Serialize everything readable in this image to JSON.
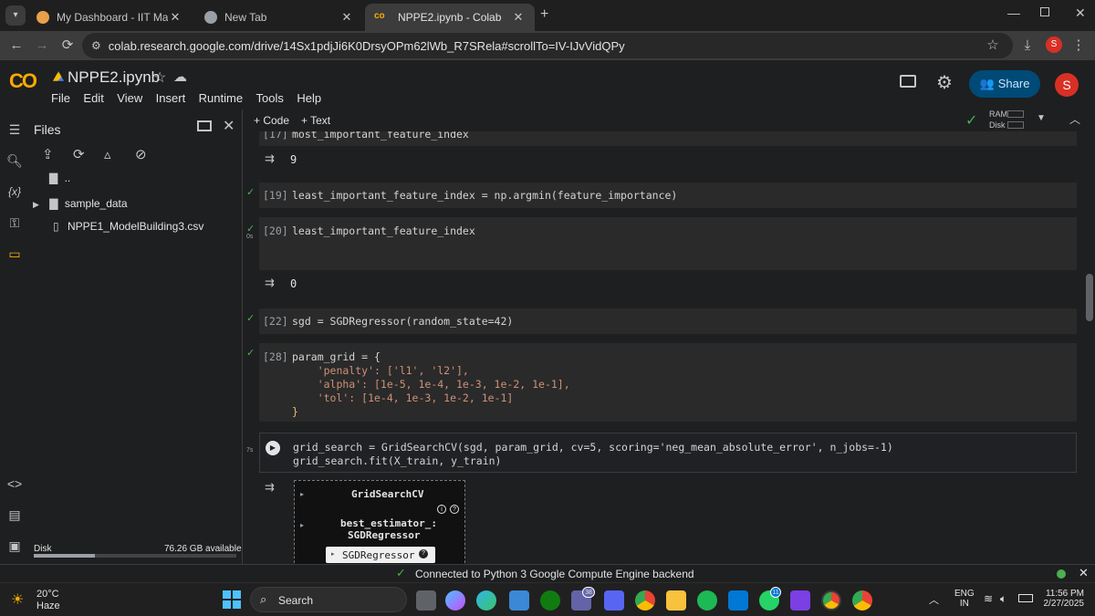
{
  "browser": {
    "tabs": [
      {
        "title": "My Dashboard - IIT Madras Onl"
      },
      {
        "title": "New Tab"
      },
      {
        "title": "NPPE2.ipynb - Colab"
      }
    ],
    "url": "colab.research.google.com/drive/14Sx1pdjJi6K0DrsyOPm62lWb_R7SRela#scrollTo=IV-IJvVidQPy",
    "profile_initial": "S"
  },
  "colab": {
    "logo": "CO",
    "notebook_title": "NPPE2.ipynb",
    "menu": [
      "File",
      "Edit",
      "View",
      "Insert",
      "Runtime",
      "Tools",
      "Help"
    ],
    "share_label": "Share",
    "avatar": "S",
    "add_code": "+ Code",
    "add_text": "+ Text",
    "ram_label": "RAM",
    "disk_label": "Disk"
  },
  "files": {
    "title": "Files",
    "up_label": "..",
    "items": [
      {
        "name": "sample_data"
      },
      {
        "name": "NPPE1_ModelBuilding3.csv"
      }
    ],
    "disk_label": "Disk",
    "disk_available": "76.26 GB available"
  },
  "cells": {
    "c17_num": "[17]",
    "c17_code": "most_important_feature_index",
    "c17_out": "9",
    "c19_num": "[19]",
    "c19_code": "least_important_feature_index = np.argmin(feature_importance)",
    "c20_num": "[20]",
    "c20_code": "least_important_feature_index",
    "c20_time": "0s",
    "c20_out": "0",
    "c22_num": "[22]",
    "c22_code": "sgd = SGDRegressor(random_state=42)",
    "c28_num": "[28]",
    "c28_line1": "param_grid = {",
    "c28_line2": "    'penalty': ['l1', 'l2'],",
    "c28_line3": "    'alpha': [1e-5, 1e-4, 1e-3, 1e-2, 1e-1],",
    "c28_line4": "    'tol': [1e-4, 1e-3, 1e-2, 1e-1]",
    "c28_line5": "}",
    "run_time": "7s",
    "run_line1": "grid_search = GridSearchCV(sgd, param_grid, cv=5, scoring='neg_mean_absolute_error', n_jobs=-1)",
    "run_line2": "grid_search.fit(X_train, y_train)",
    "widget_title": "GridSearchCV",
    "widget_best": "best_estimator_:",
    "widget_best_sub": "SGDRegressor",
    "widget_leaf": "SGDRegressor"
  },
  "status": {
    "text": "Connected to Python 3 Google Compute Engine backend"
  },
  "taskbar": {
    "weather_temp": "20°C",
    "weather_desc": "Haze",
    "search": "Search",
    "badge_teams": "38",
    "badge_vs": "11",
    "lang1": "ENG",
    "lang2": "IN",
    "time": "11:56 PM",
    "date": "2/27/2025"
  },
  "colors": {
    "accent": "#0b57d0",
    "share_bg": "#004a77",
    "ok": "#4caf50",
    "avatar": "#d93025"
  }
}
